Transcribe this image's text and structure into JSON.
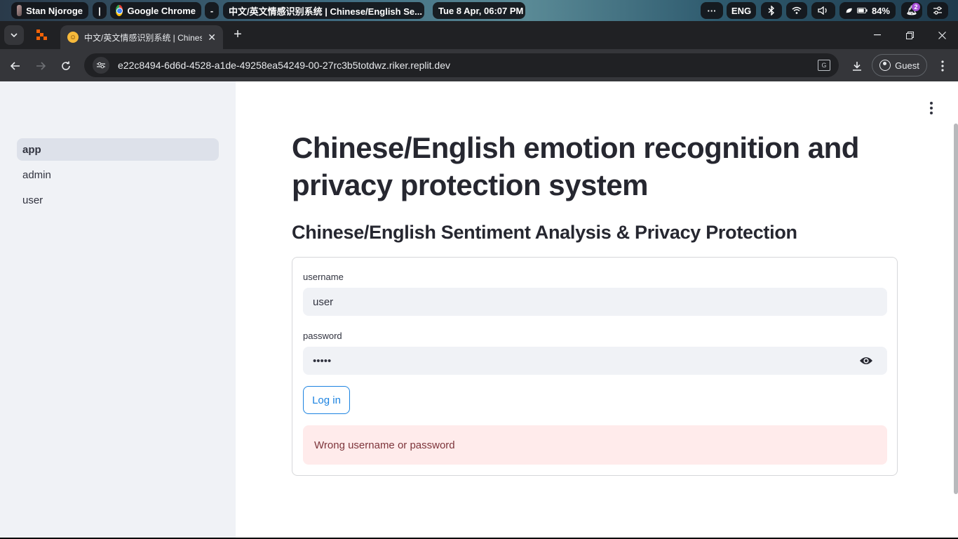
{
  "taskbar": {
    "user_name": "Stan Njoroge",
    "separator": "|",
    "app_name": "Google Chrome",
    "dash": "-",
    "window_title": "中文/英文情感识别系统 | Chinese/English Se...",
    "datetime": "Tue 8 Apr, 06:07 PM",
    "more": "···",
    "language": "ENG",
    "battery": "84%",
    "notification_count": "2"
  },
  "browser": {
    "tab_title": "中文/英文情感识别系统 | Chinese/English Sentiment Analysis",
    "url": "e22c8494-6d6d-4528-a1de-49258ea54249-00-27rc3b5totdwz.riker.replit.dev",
    "profile_label": "Guest"
  },
  "sidebar": {
    "items": [
      {
        "label": "app",
        "active": true
      },
      {
        "label": "admin",
        "active": false
      },
      {
        "label": "user",
        "active": false
      }
    ]
  },
  "main": {
    "title": "Chinese/English emotion recognition and privacy protection system",
    "subtitle": "Chinese/English Sentiment Analysis & Privacy Protection",
    "form": {
      "username_label": "username",
      "username_value": "user",
      "password_label": "password",
      "password_value": "•••••",
      "login_label": "Log in",
      "error_message": "Wrong username or password"
    }
  },
  "colors": {
    "sidebar_bg": "#f0f2f6",
    "primary": "#1c83e1",
    "error_bg": "#ffebeb",
    "error_text": "#7d353b",
    "text": "#262730"
  }
}
